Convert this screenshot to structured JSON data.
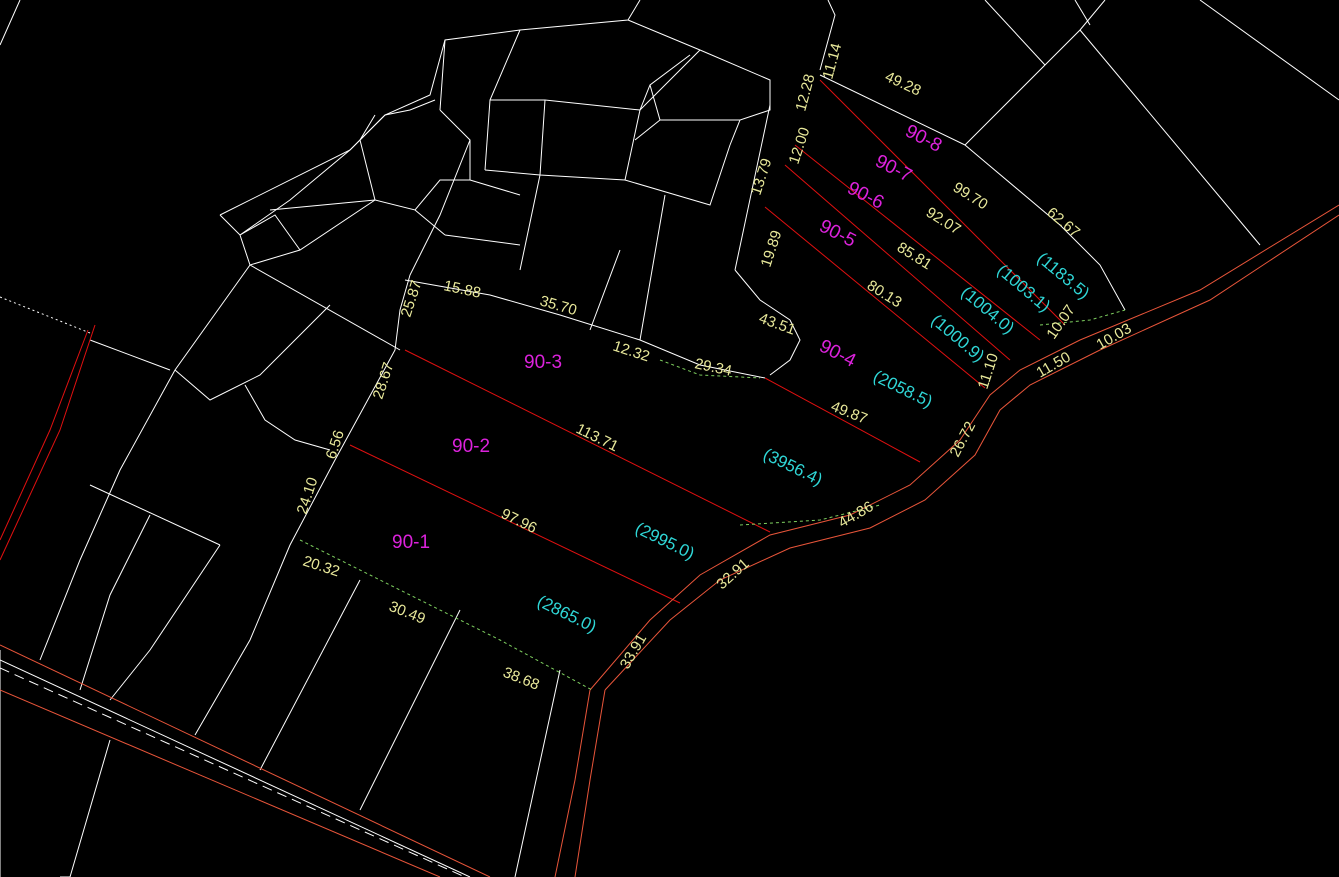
{
  "colors": {
    "background": "#000000",
    "boundary": "#ffffff",
    "division_line": "#e01010",
    "road_edge": "#e8553a",
    "parcel_label": "#dc22dc",
    "area_label": "#2fd6d6",
    "dimension_label": "#e8e89a"
  },
  "parcels": [
    {
      "id": "90-1",
      "area": "(2865.0)"
    },
    {
      "id": "90-2",
      "area": "(2995.0)"
    },
    {
      "id": "90-3",
      "area": "(3956.4)"
    },
    {
      "id": "90-4",
      "area": "(2058.5)"
    },
    {
      "id": "90-5",
      "area": "(1000.9)"
    },
    {
      "id": "90-6",
      "area": "(1004.0)"
    },
    {
      "id": "90-7",
      "area": "(1003.1)"
    },
    {
      "id": "90-8",
      "area": "(1183.5)"
    }
  ],
  "dimensions": {
    "d_11_14": "11.14",
    "d_12_28": "12.28",
    "d_49_28": "49.28",
    "d_12_00": "12.00",
    "d_13_79": "13.79",
    "d_99_70": "99.70",
    "d_62_67": "62.67",
    "d_92_07": "92.07",
    "d_19_89": "19.89",
    "d_85_81": "85.81",
    "d_25_87": "25.87",
    "d_15_88": "15.88",
    "d_35_70": "35.70",
    "d_80_13": "80.13",
    "d_43_51": "43.51",
    "d_10_07": "10.07",
    "d_10_03": "10.03",
    "d_12_32": "12.32",
    "d_29_34": "29.34",
    "d_11_50": "11.50",
    "d_11_10": "11.10",
    "d_28_67": "28.67",
    "d_49_87": "49.87",
    "d_113_71": "113.71",
    "d_6_56": "6.56",
    "d_26_72": "26.72",
    "d_24_10": "24.10",
    "d_97_96": "97.96",
    "d_44_86": "44.86",
    "d_20_32": "20.32",
    "d_32_91": "32.91",
    "d_30_49": "30.49",
    "d_33_91": "33.91",
    "d_38_68": "38.68"
  }
}
